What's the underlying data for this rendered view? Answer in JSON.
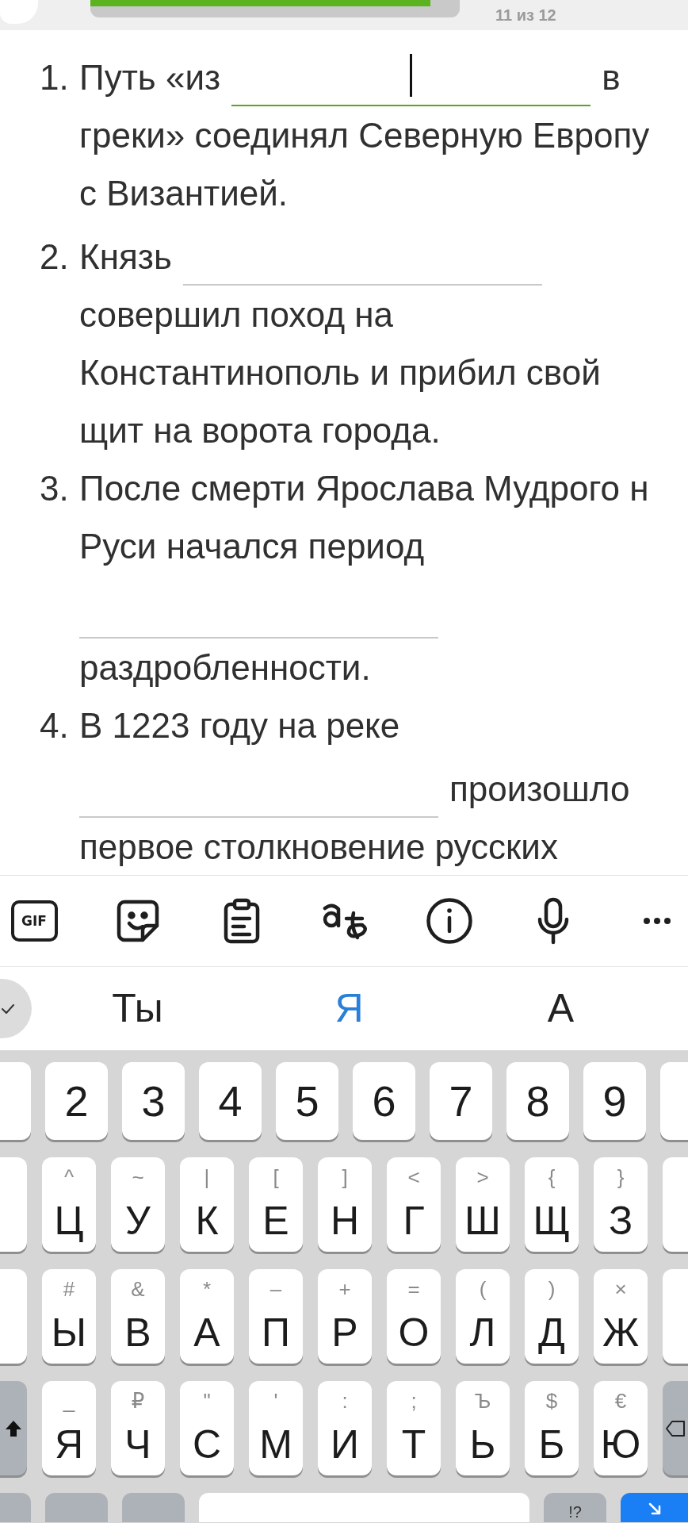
{
  "top_bar": {
    "progress": {
      "level": 0.92
    },
    "counter": "11 из 12"
  },
  "questions": [
    {
      "number": "1.",
      "lines": [
        [
          {
            "kind": "text",
            "text": "Путь «из"
          },
          {
            "kind": "blank",
            "focused": true
          },
          {
            "kind": "text",
            "text": "в"
          }
        ],
        [
          {
            "kind": "text",
            "text": "греки» соединял Северную Европу"
          }
        ],
        [
          {
            "kind": "text",
            "text": "с Византией."
          }
        ]
      ]
    },
    {
      "number": "2.",
      "lines": [
        [
          {
            "kind": "text",
            "text": "Князь"
          },
          {
            "kind": "blank",
            "focused": false
          }
        ],
        [
          {
            "kind": "text",
            "text": "совершил поход на"
          }
        ],
        [
          {
            "kind": "text",
            "text": "Константинополь и прибил свой"
          }
        ],
        [
          {
            "kind": "text",
            "text": "щит на ворота города."
          }
        ]
      ]
    },
    {
      "number": "3.",
      "lines": [
        [
          {
            "kind": "text",
            "text": "После смерти Ярослава Мудрого н"
          }
        ],
        [
          {
            "kind": "text",
            "text": "Руси начался период"
          }
        ],
        [
          {
            "kind": "blank",
            "focused": false
          }
        ],
        [
          {
            "kind": "text",
            "text": "раздробленности."
          }
        ]
      ]
    },
    {
      "number": "4.",
      "lines": [
        [
          {
            "kind": "text",
            "text": "В 1223 году на реке"
          }
        ],
        [
          {
            "kind": "blank",
            "focused": false
          },
          {
            "kind": "text",
            "text": "произошло"
          }
        ],
        [
          {
            "kind": "text",
            "text": "первое столкновение русских"
          }
        ]
      ]
    }
  ],
  "keyboard": {
    "toolbar": [
      {
        "kind": "gif",
        "label": "GIF"
      },
      {
        "kind": "sticker"
      },
      {
        "kind": "clipboard"
      },
      {
        "kind": "translate"
      },
      {
        "kind": "info"
      },
      {
        "kind": "mic"
      },
      {
        "kind": "more"
      }
    ],
    "suggestions": [
      {
        "text": "Ты",
        "selected": false
      },
      {
        "text": "Я",
        "selected": true
      },
      {
        "text": "А",
        "selected": false
      }
    ],
    "rows": [
      {
        "kind": "digits",
        "keys": [
          {
            "kind": "edge"
          },
          {
            "kind": "char",
            "label": "2"
          },
          {
            "kind": "char",
            "label": "3"
          },
          {
            "kind": "char",
            "label": "4"
          },
          {
            "kind": "char",
            "label": "5"
          },
          {
            "kind": "char",
            "label": "6"
          },
          {
            "kind": "char",
            "label": "7"
          },
          {
            "kind": "char",
            "label": "8"
          },
          {
            "kind": "char",
            "label": "9"
          },
          {
            "kind": "edge"
          }
        ]
      },
      {
        "kind": "letters",
        "keys": [
          {
            "kind": "edge"
          },
          {
            "kind": "char",
            "label": "Ц",
            "hint": "^"
          },
          {
            "kind": "char",
            "label": "У",
            "hint": "~"
          },
          {
            "kind": "char",
            "label": "К",
            "hint": "|"
          },
          {
            "kind": "char",
            "label": "Е",
            "hint": "["
          },
          {
            "kind": "char",
            "label": "Н",
            "hint": "]"
          },
          {
            "kind": "char",
            "label": "Г",
            "hint": "<"
          },
          {
            "kind": "char",
            "label": "Ш",
            "hint": ">"
          },
          {
            "kind": "char",
            "label": "Щ",
            "hint": "{"
          },
          {
            "kind": "char",
            "label": "З",
            "hint": "}"
          },
          {
            "kind": "edge"
          }
        ]
      },
      {
        "kind": "letters",
        "keys": [
          {
            "kind": "edge"
          },
          {
            "kind": "char",
            "label": "Ы",
            "hint": "#"
          },
          {
            "kind": "char",
            "label": "В",
            "hint": "&"
          },
          {
            "kind": "char",
            "label": "А",
            "hint": "*"
          },
          {
            "kind": "char",
            "label": "П",
            "hint": "–"
          },
          {
            "kind": "char",
            "label": "Р",
            "hint": "+"
          },
          {
            "kind": "char",
            "label": "О",
            "hint": "="
          },
          {
            "kind": "char",
            "label": "Л",
            "hint": "("
          },
          {
            "kind": "char",
            "label": "Д",
            "hint": ")"
          },
          {
            "kind": "char",
            "label": "Ж",
            "hint": "×"
          },
          {
            "kind": "edge"
          }
        ]
      },
      {
        "kind": "letters",
        "keys": [
          {
            "kind": "shift"
          },
          {
            "kind": "char",
            "label": "Я",
            "hint": "_"
          },
          {
            "kind": "char",
            "label": "Ч",
            "hint": "₽"
          },
          {
            "kind": "char",
            "label": "С",
            "hint": "\""
          },
          {
            "kind": "char",
            "label": "М",
            "hint": "'"
          },
          {
            "kind": "char",
            "label": "И",
            "hint": ":"
          },
          {
            "kind": "char",
            "label": "Т",
            "hint": ";"
          },
          {
            "kind": "char",
            "label": "Ь",
            "hint": "Ъ"
          },
          {
            "kind": "char",
            "label": "Б",
            "hint": "$"
          },
          {
            "kind": "char",
            "label": "Ю",
            "hint": "€"
          },
          {
            "kind": "backspace"
          }
        ]
      },
      {
        "kind": "bottom",
        "keys": [
          {
            "kind": "fn_edge"
          },
          {
            "kind": "fn"
          },
          {
            "kind": "fn"
          },
          {
            "kind": "space"
          },
          {
            "kind": "fn",
            "label": "!?"
          },
          {
            "kind": "enter"
          }
        ]
      }
    ]
  }
}
